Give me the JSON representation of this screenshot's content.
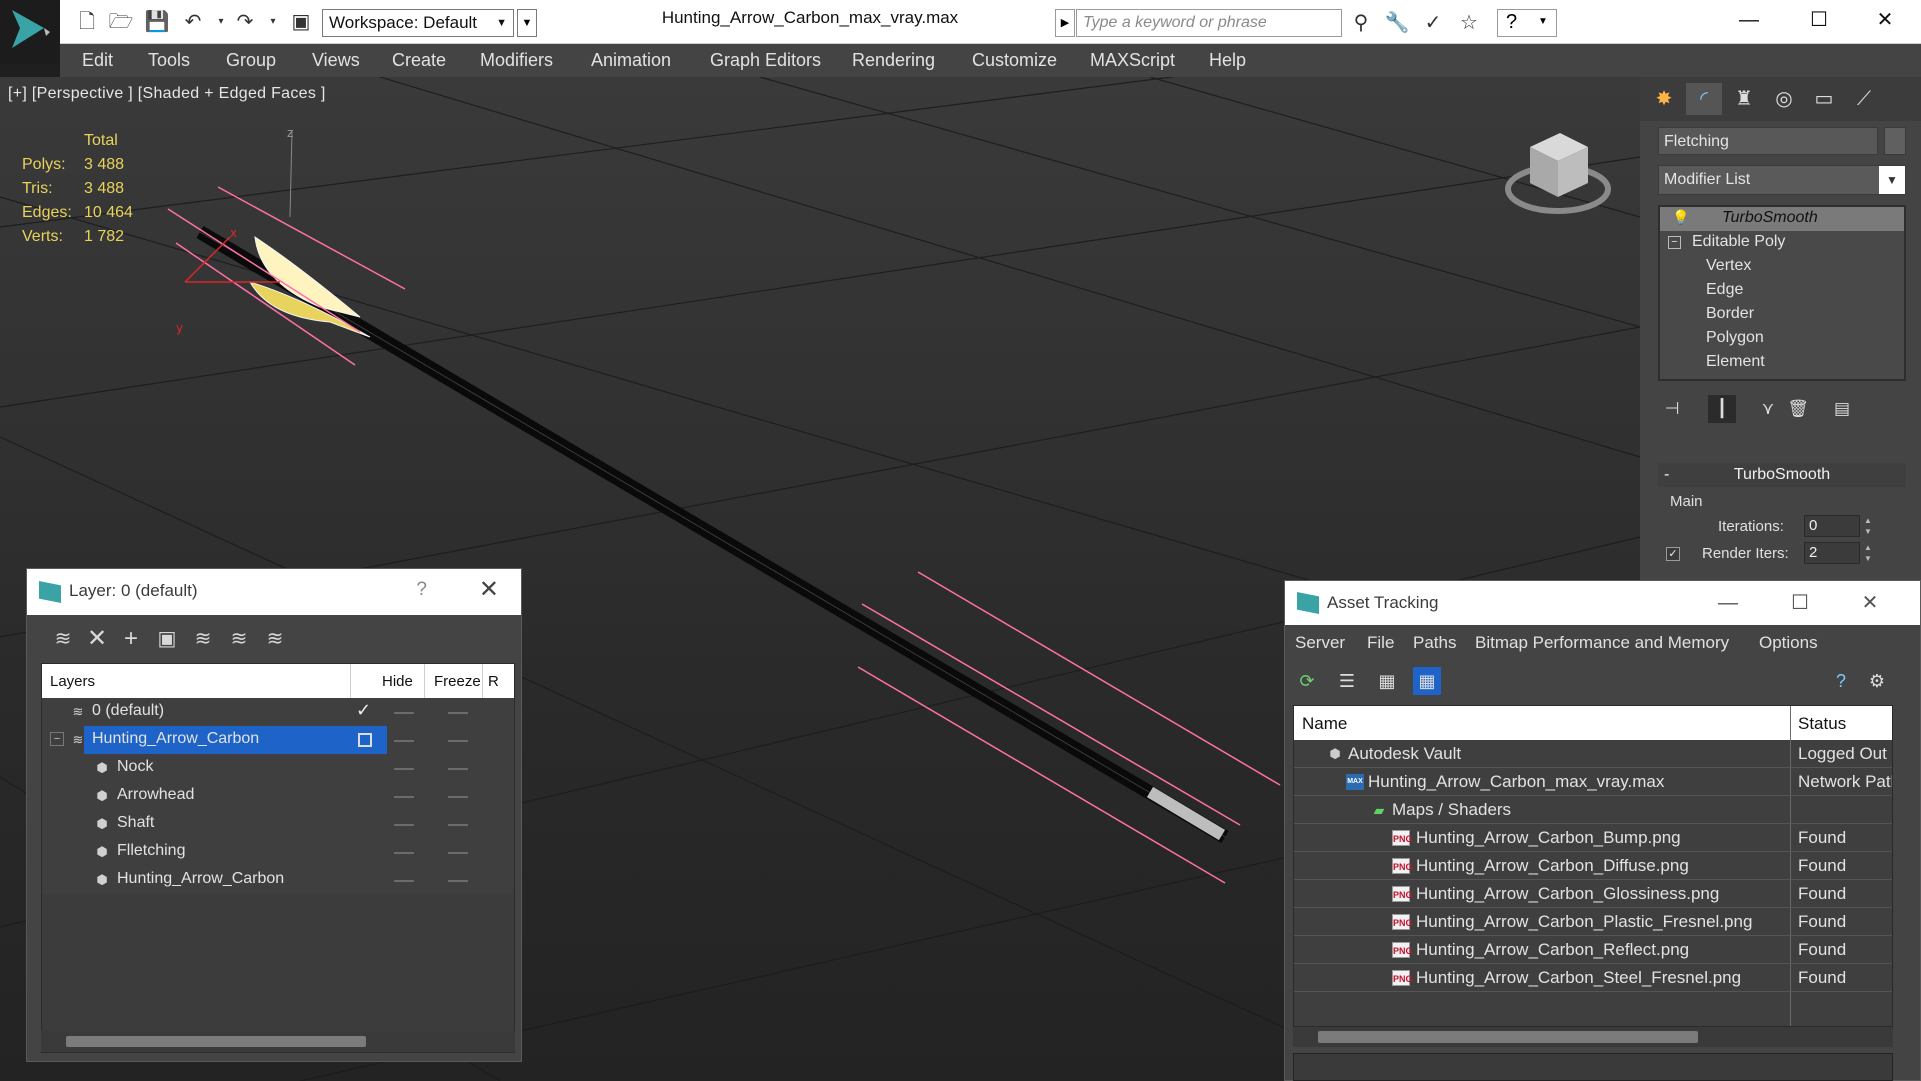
{
  "app": {
    "document_title": "Hunting_Arrow_Carbon_max_vray.max",
    "workspace": "Workspace: Default",
    "search_placeholder": "Type a keyword or phrase"
  },
  "menu": [
    "Edit",
    "Tools",
    "Group",
    "Views",
    "Create",
    "Modifiers",
    "Animation",
    "Graph Editors",
    "Rendering",
    "Customize",
    "MAXScript",
    "Help"
  ],
  "viewport": {
    "label": "[+] [Perspective ] [Shaded + Edged Faces ]",
    "stats": {
      "header": "Total",
      "rows": [
        {
          "k": "Polys:",
          "v": "3 488"
        },
        {
          "k": "Tris:",
          "v": "3 488"
        },
        {
          "k": "Edges:",
          "v": "10 464"
        },
        {
          "k": "Verts:",
          "v": "1 782"
        }
      ]
    },
    "gizmo_labels": {
      "z": "z",
      "x": "x",
      "y": "y"
    }
  },
  "layer_dialog": {
    "title": "Layer: 0 (default)",
    "help": "?",
    "columns": {
      "layers": "Layers",
      "hide": "Hide",
      "freeze": "Freeze",
      "render": "R"
    },
    "rows": [
      {
        "name": "0 (default)",
        "indent": 1
      },
      {
        "name": "Hunting_Arrow_Carbon",
        "indent": 1
      },
      {
        "name": "Nock",
        "indent": 2
      },
      {
        "name": "Arrowhead",
        "indent": 2
      },
      {
        "name": "Shaft",
        "indent": 2
      },
      {
        "name": "Flletching",
        "indent": 2
      },
      {
        "name": "Hunting_Arrow_Carbon",
        "indent": 2
      }
    ]
  },
  "command_panel": {
    "object_name": "Fletching",
    "modifier_list": "Modifier List",
    "stack": [
      {
        "label": "TurboSmooth"
      },
      {
        "label": "Editable Poly"
      },
      {
        "label": "Vertex"
      },
      {
        "label": "Edge"
      },
      {
        "label": "Border"
      },
      {
        "label": "Polygon"
      },
      {
        "label": "Element"
      }
    ],
    "rollout": {
      "title": "TurboSmooth",
      "collapse": "-",
      "group": "Main",
      "iterations_label": "Iterations:",
      "iterations": "0",
      "render_iters_label": "Render Iters:",
      "render_iters": "2"
    }
  },
  "asset_tracking": {
    "title": "Asset Tracking",
    "menu": [
      "Server",
      "File",
      "Paths",
      "Bitmap Performance and Memory",
      "Options"
    ],
    "columns": {
      "name": "Name",
      "status": "Status"
    },
    "rows": [
      {
        "name": "Autodesk Vault",
        "status": "Logged Out"
      },
      {
        "name": "Hunting_Arrow_Carbon_max_vray.max",
        "status": "Network Path"
      },
      {
        "name": "Maps / Shaders",
        "status": ""
      },
      {
        "name": "Hunting_Arrow_Carbon_Bump.png",
        "status": "Found"
      },
      {
        "name": "Hunting_Arrow_Carbon_Diffuse.png",
        "status": "Found"
      },
      {
        "name": "Hunting_Arrow_Carbon_Glossiness.png",
        "status": "Found"
      },
      {
        "name": "Hunting_Arrow_Carbon_Plastic_Fresnel.png",
        "status": "Found"
      },
      {
        "name": "Hunting_Arrow_Carbon_Reflect.png",
        "status": "Found"
      },
      {
        "name": "Hunting_Arrow_Carbon_Steel_Fresnel.png",
        "status": "Found"
      }
    ]
  },
  "icons": {
    "png_badge": "PNG",
    "max_badge": "MAX"
  },
  "colors": {
    "accent": "#1e64c8",
    "stats_yellow": "#e8d35c",
    "selection_pink": "#ff6fa8"
  }
}
